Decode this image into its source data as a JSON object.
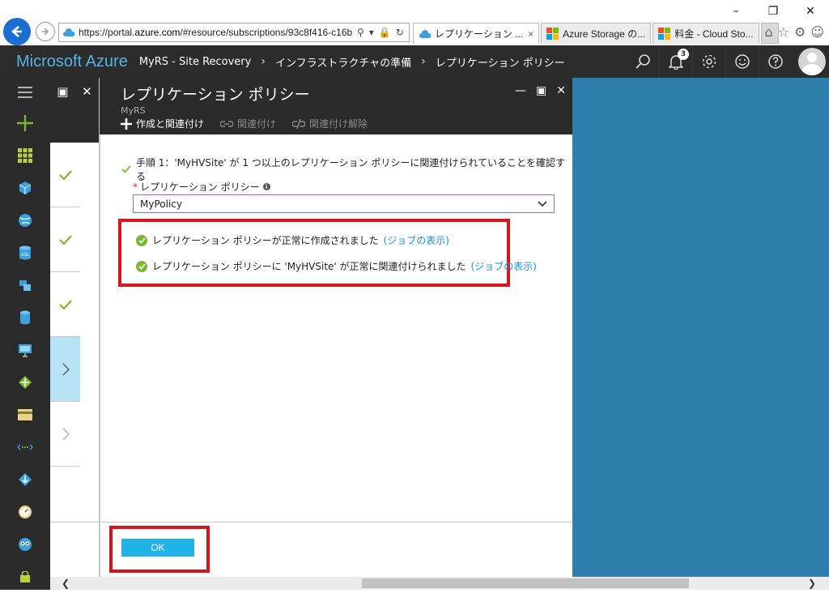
{
  "browser": {
    "url_prefix": "https://portal.",
    "url_domain": "azure.com",
    "url_rest": "/#resource/subscriptions/93c8f416-c16b",
    "tabs": [
      {
        "label": "レプリケーション ...",
        "close": "×"
      },
      {
        "label": "Azure Storage の..."
      },
      {
        "label": "料金 - Cloud Sto..."
      }
    ],
    "ms_colors": [
      "#f25022",
      "#7fba00",
      "#00a4ef",
      "#ffb900"
    ]
  },
  "header": {
    "brand": "Microsoft Azure",
    "breadcrumbs": [
      "MyRS - Site Recovery",
      "インフラストラクチャの準備",
      "レプリケーション ポリシー"
    ],
    "notification_count": "3"
  },
  "blade": {
    "title": "レプリケーション ポリシー",
    "subtitle": "MyRS",
    "commands": {
      "create": "作成と関連付け",
      "associate": "関連付け",
      "dissociate": "関連付け解除"
    },
    "step1": "手順 1：'MyHVSite' が 1 つ以上のレプリケーション ポリシーに関連付けられていることを確認する",
    "policy_label": "レプリケーション ポリシー",
    "policy_value": "MyPolicy",
    "messages": [
      {
        "text": "レプリケーション ポリシーが正常に作成されました",
        "link": "(ジョブの表示)"
      },
      {
        "text": "レプリケーション ポリシーに 'MyHVSite' が正常に関連付けられました",
        "link": "(ジョブの表示)"
      }
    ],
    "ok_label": "OK"
  },
  "colors": {
    "accent": "#1fb3e8",
    "highlight": "#d9141e",
    "success": "#7cb82f",
    "nav_bg": "#2b2b2b",
    "brand": "#55b3e6"
  }
}
